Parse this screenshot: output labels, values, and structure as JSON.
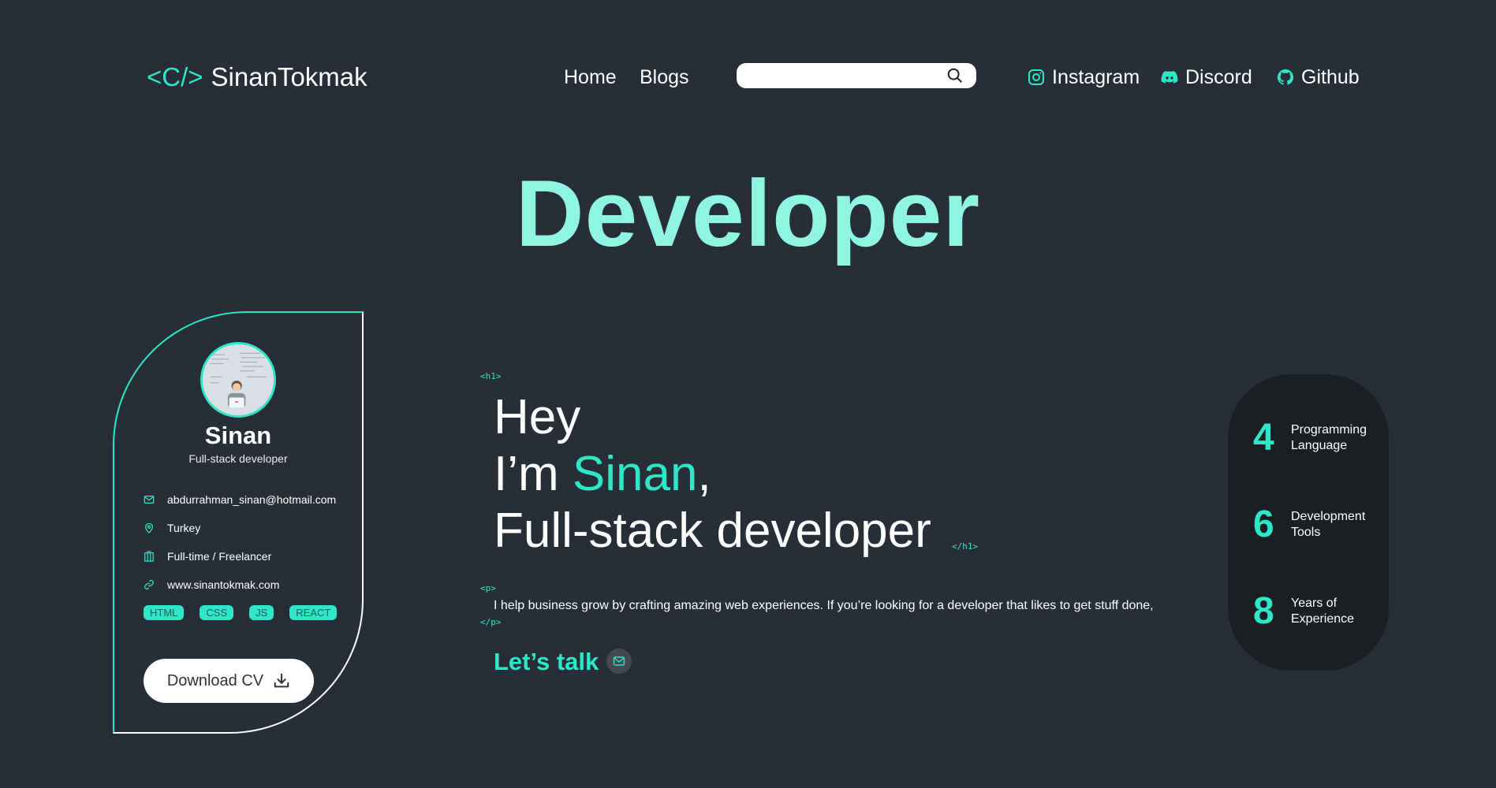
{
  "nav": {
    "logo_code": "<C/>",
    "logo_name": "SinanTokmak",
    "links": [
      "Home",
      "Blogs"
    ],
    "search_placeholder": "",
    "social": [
      "Instagram",
      "Discord",
      "Github"
    ]
  },
  "hero": {
    "title": "Developer"
  },
  "card": {
    "name": "Sinan",
    "role": "Full-stack developer",
    "email": "abdurrahman_sinan@hotmail.com",
    "location": "Turkey",
    "employment": "Full-time / Freelancer",
    "website": "www.sinantokmak.com",
    "tags": [
      "HTML",
      "CSS",
      "JS",
      "REACT"
    ],
    "cv_button": "Download CV"
  },
  "intro": {
    "h1_open": "<h1>",
    "h1_close": "</h1>",
    "line1": "Hey",
    "line2_prefix": "I’m ",
    "line2_name": "Sinan",
    "line2_suffix": ",",
    "line3": "Full-stack developer",
    "p_open": "<p>",
    "p_close": "</p>",
    "paragraph": "I help business grow by crafting amazing web experiences. If you’re looking for a developer that likes to get stuff done,",
    "cta": "Let’s talk"
  },
  "stats": [
    {
      "value": "4",
      "label": "Programming Language"
    },
    {
      "value": "6",
      "label": "Development Tools"
    },
    {
      "value": "8",
      "label": "Years of Experience"
    }
  ],
  "colors": {
    "background": "#282e37",
    "accent": "#2ee6c8",
    "hero_title": "#8ff5e2",
    "stats_panel": "#1b1e22"
  }
}
